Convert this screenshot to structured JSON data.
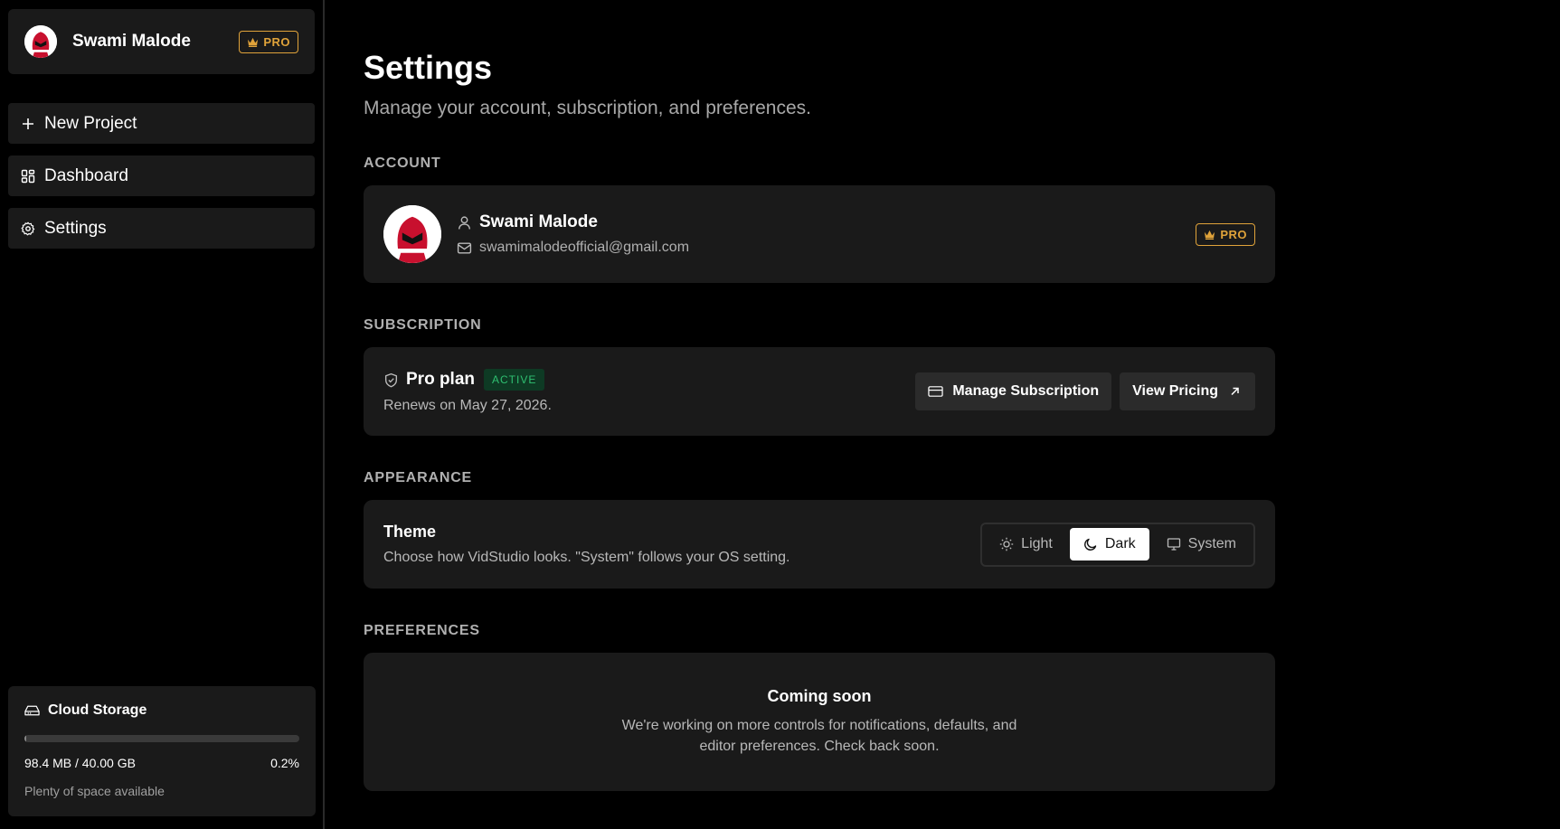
{
  "sidebar": {
    "user_name": "Swami Malode",
    "badge": "PRO",
    "nav": [
      {
        "label": "New Project",
        "icon": "plus-icon"
      },
      {
        "label": "Dashboard",
        "icon": "dashboard-icon"
      },
      {
        "label": "Settings",
        "icon": "gear-icon"
      }
    ],
    "storage": {
      "title": "Cloud Storage",
      "usage": "98.4 MB / 40.00 GB",
      "percent_text": "0.2%",
      "percent": 0.2,
      "note": "Plenty of space available"
    }
  },
  "main": {
    "title": "Settings",
    "subtitle": "Manage your account, subscription, and preferences.",
    "account": {
      "section": "ACCOUNT",
      "name": "Swami Malode",
      "email": "swamimalodeofficial@gmail.com",
      "badge": "PRO"
    },
    "subscription": {
      "section": "SUBSCRIPTION",
      "plan": "Pro plan",
      "status": "ACTIVE",
      "renews": "Renews on May 27, 2026.",
      "manage_label": "Manage Subscription",
      "pricing_label": "View Pricing"
    },
    "appearance": {
      "section": "APPEARANCE",
      "title": "Theme",
      "description": "Choose how VidStudio looks. \"System\" follows your OS setting.",
      "options": [
        "Light",
        "Dark",
        "System"
      ],
      "selected": "Dark"
    },
    "preferences": {
      "section": "PREFERENCES",
      "title": "Coming soon",
      "description": "We're working on more controls for notifications, defaults, and editor preferences. Check back soon."
    }
  },
  "colors": {
    "accent_gold": "#e0a33a",
    "active_green": "#2fbf71",
    "card_bg": "#1a1a1a"
  }
}
